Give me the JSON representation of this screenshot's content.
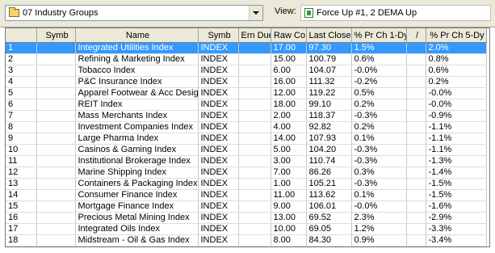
{
  "toolbar": {
    "group_combo": "07 Industry  Groups",
    "view_label": "View:",
    "view_value": "Force  Up #1, 2 DEMA Up"
  },
  "table": {
    "headers": [
      "",
      "Symb",
      "Name",
      "Symb",
      "Ern Due",
      "Raw Co",
      "Last Close",
      "% Pr Ch 1-Dy",
      "/",
      "% Pr Ch 5-Dy"
    ],
    "rows": [
      {
        "n": "1",
        "name": "Integrated Utilities Index",
        "symb": "INDEX",
        "raw": "17.00",
        "close": "97.30",
        "ch1": "1.5%",
        "ch5": "2.0%"
      },
      {
        "n": "2",
        "name": "Refining & Marketing Index",
        "symb": "INDEX",
        "raw": "15.00",
        "close": "100.79",
        "ch1": "0.6%",
        "ch5": "0.8%"
      },
      {
        "n": "3",
        "name": "Tobacco Index",
        "symb": "INDEX",
        "raw": "6.00",
        "close": "104.07",
        "ch1": "-0.0%",
        "ch5": "0.6%"
      },
      {
        "n": "4",
        "name": "P&C Insurance Index",
        "symb": "INDEX",
        "raw": "16.00",
        "close": "111.32",
        "ch1": "-0.2%",
        "ch5": "0.2%"
      },
      {
        "n": "5",
        "name": "Apparel Footwear & Acc Design Index",
        "symb": "INDEX",
        "raw": "12.00",
        "close": "119.22",
        "ch1": "0.5%",
        "ch5": "-0.0%"
      },
      {
        "n": "6",
        "name": "REIT Index",
        "symb": "INDEX",
        "raw": "18.00",
        "close": "99.10",
        "ch1": "0.2%",
        "ch5": "-0.0%"
      },
      {
        "n": "7",
        "name": "Mass Merchants Index",
        "symb": "INDEX",
        "raw": "2.00",
        "close": "118.37",
        "ch1": "-0.3%",
        "ch5": "-0.9%"
      },
      {
        "n": "8",
        "name": "Investment Companies Index",
        "symb": "INDEX",
        "raw": "4.00",
        "close": "92.82",
        "ch1": "0.2%",
        "ch5": "-1.1%"
      },
      {
        "n": "9",
        "name": "Large Pharma Index",
        "symb": "INDEX",
        "raw": "14.00",
        "close": "107.93",
        "ch1": "0.1%",
        "ch5": "-1.1%"
      },
      {
        "n": "10",
        "name": "Casinos & Gaming Index",
        "symb": "INDEX",
        "raw": "5.00",
        "close": "104.20",
        "ch1": "-0.3%",
        "ch5": "-1.1%"
      },
      {
        "n": "11",
        "name": "Institutional Brokerage Index",
        "symb": "INDEX",
        "raw": "3.00",
        "close": "110.74",
        "ch1": "-0.3%",
        "ch5": "-1.3%"
      },
      {
        "n": "12",
        "name": "Marine Shipping Index",
        "symb": "INDEX",
        "raw": "7.00",
        "close": "86.26",
        "ch1": "0.3%",
        "ch5": "-1.4%"
      },
      {
        "n": "13",
        "name": "Containers & Packaging Index",
        "symb": "INDEX",
        "raw": "1.00",
        "close": "105.21",
        "ch1": "-0.3%",
        "ch5": "-1.5%"
      },
      {
        "n": "14",
        "name": "Consumer Finance Index",
        "symb": "INDEX",
        "raw": "11.00",
        "close": "113.62",
        "ch1": "0.1%",
        "ch5": "-1.5%"
      },
      {
        "n": "15",
        "name": "Mortgage Finance Index",
        "symb": "INDEX",
        "raw": "9.00",
        "close": "106.01",
        "ch1": "-0.0%",
        "ch5": "-1.6%"
      },
      {
        "n": "16",
        "name": "Precious Metal Mining Index",
        "symb": "INDEX",
        "raw": "13.00",
        "close": "69.52",
        "ch1": "2.3%",
        "ch5": "-2.9%"
      },
      {
        "n": "17",
        "name": "Integrated Oils Index",
        "symb": "INDEX",
        "raw": "10.00",
        "close": "69.05",
        "ch1": "1.2%",
        "ch5": "-3.3%"
      },
      {
        "n": "18",
        "name": "Midstream - Oil & Gas Index",
        "symb": "INDEX",
        "raw": "8.00",
        "close": "84.30",
        "ch1": "0.9%",
        "ch5": "-3.4%"
      }
    ]
  }
}
